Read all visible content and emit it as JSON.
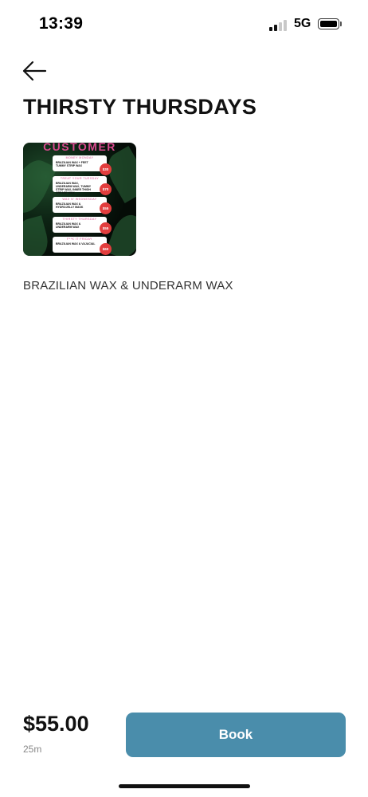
{
  "status": {
    "time": "13:39",
    "network": "5G"
  },
  "service": {
    "title": "THIRSTY THURSDAYS",
    "description": "BRAZILIAN WAX & UNDERARM WAX",
    "price": "$55.00",
    "duration": "25m"
  },
  "flyer": {
    "heading": "CUSTOMER",
    "cards": [
      {
        "day": "MONEY MONDAY",
        "text": "BRAZILIAN WAX + FEET TUMMY STRIP WAX",
        "price": "$30"
      },
      {
        "day": "TREAT YOUR TUESDAY",
        "text": "BRAZILIAN WAX, UNDERARM WAX, TUMMY STRIP WAX, INNER THIGH CREASE WAX",
        "price": "$70"
      },
      {
        "day": "WAX N' WEDNESDAY",
        "text": "BRAZILIAN WAX & HYDROJELLY MASK",
        "price": "$55"
      },
      {
        "day": "THIRSTY THURSDAY",
        "text": "BRAZILIAN WAX & UNDERARM WAX",
        "price": "$55"
      },
      {
        "day": "F**K IT FRIDAY",
        "text": "BRAZILIAN WAX & VAJACIAL",
        "price": "$60"
      }
    ]
  },
  "actions": {
    "book_label": "Book"
  },
  "icons": {
    "back": "arrow-left-icon"
  },
  "colors": {
    "accent": "#4a8dab",
    "price_dot": "#e23d3d",
    "flyer_pink": "#d94a8f"
  }
}
